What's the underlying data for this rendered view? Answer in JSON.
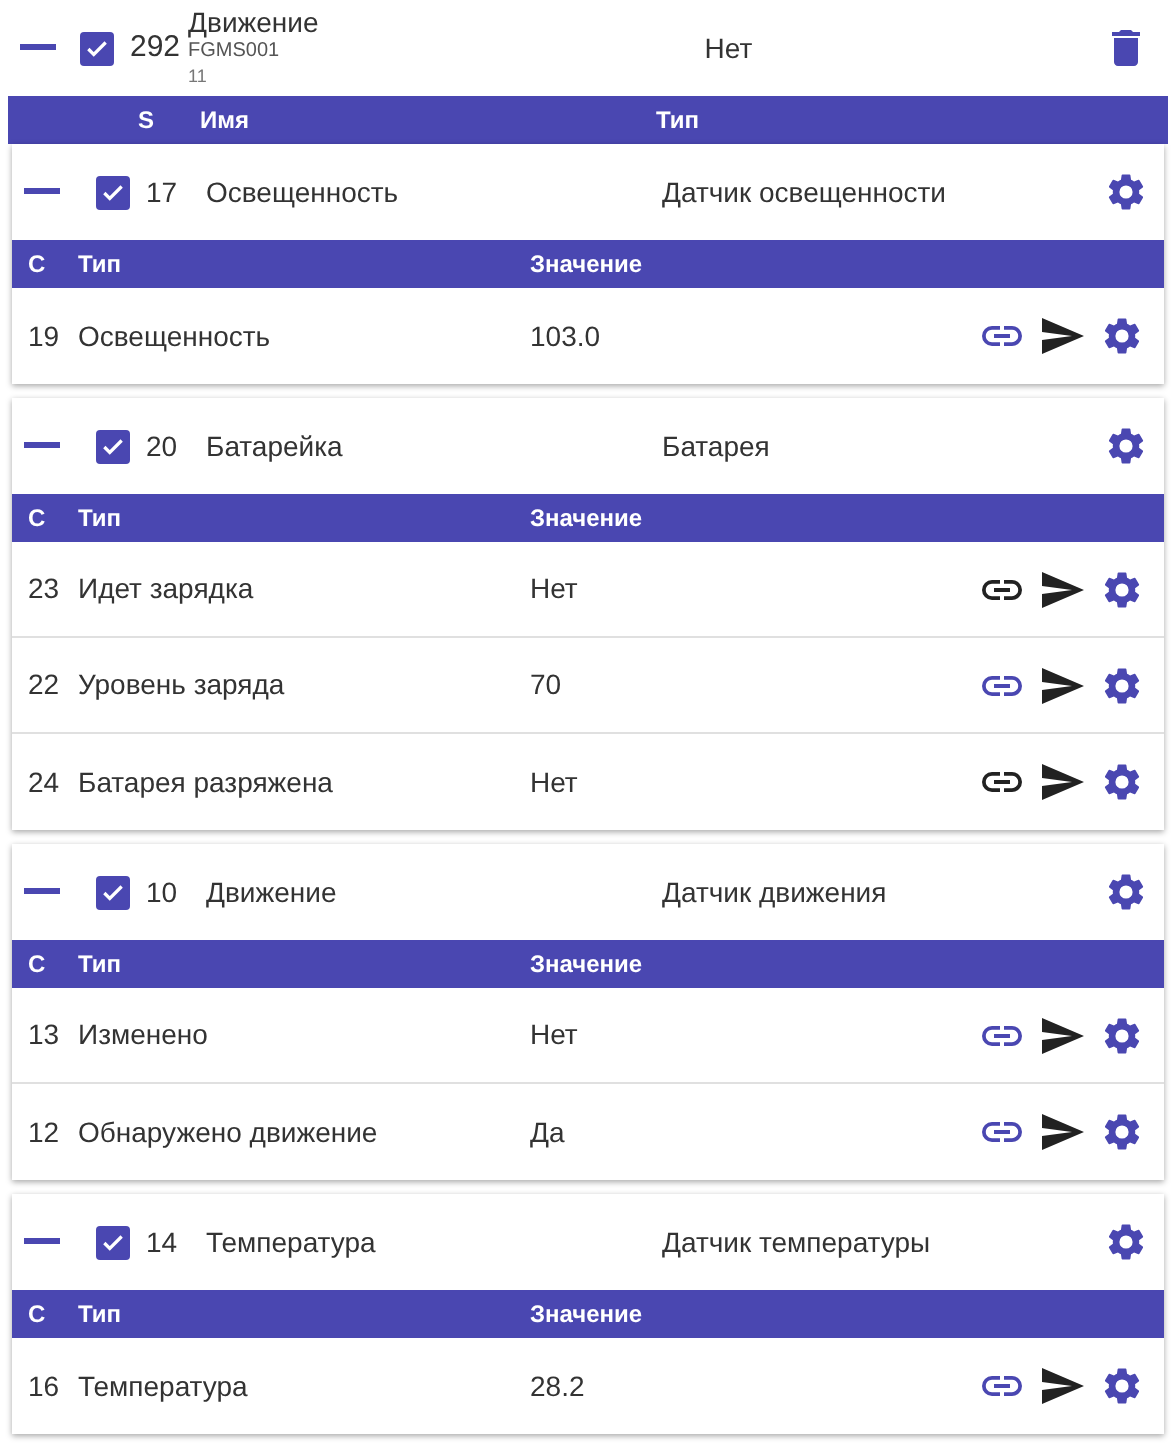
{
  "device": {
    "expanded": true,
    "checked": true,
    "id": "292",
    "name": "Движение",
    "model": "FGMS001",
    "sub": "11",
    "value": "Нет"
  },
  "columns": [
    "S",
    "Имя",
    "Тип"
  ],
  "groups": [
    {
      "expanded": true,
      "checked": true,
      "id": "17",
      "name": "Освещенность",
      "type": "Датчик освещенности",
      "columns": [
        "С",
        "Тип",
        "Значение"
      ],
      "rows": [
        {
          "id": "19",
          "type": "Освещенность",
          "value": "103.0",
          "linked": true
        }
      ]
    },
    {
      "expanded": true,
      "checked": true,
      "id": "20",
      "name": "Батарейка",
      "type": "Батарея",
      "columns": [
        "С",
        "Тип",
        "Значение"
      ],
      "rows": [
        {
          "id": "23",
          "type": "Идет зарядка",
          "value": "Нет",
          "linked": false
        },
        {
          "id": "22",
          "type": "Уровень заряда",
          "value": "70",
          "linked": true
        },
        {
          "id": "24",
          "type": "Батарея разряжена",
          "value": "Нет",
          "linked": false
        }
      ]
    },
    {
      "expanded": true,
      "checked": true,
      "id": "10",
      "name": "Движение",
      "type": "Датчик движения",
      "columns": [
        "С",
        "Тип",
        "Значение"
      ],
      "rows": [
        {
          "id": "13",
          "type": "Изменено",
          "value": "Нет",
          "linked": true
        },
        {
          "id": "12",
          "type": "Обнаружено движение",
          "value": "Да",
          "linked": true
        }
      ]
    },
    {
      "expanded": true,
      "checked": true,
      "id": "14",
      "name": "Температура",
      "type": "Датчик температуры",
      "columns": [
        "С",
        "Тип",
        "Значение"
      ],
      "rows": [
        {
          "id": "16",
          "type": "Температура",
          "value": "28.2",
          "linked": true
        }
      ]
    }
  ]
}
